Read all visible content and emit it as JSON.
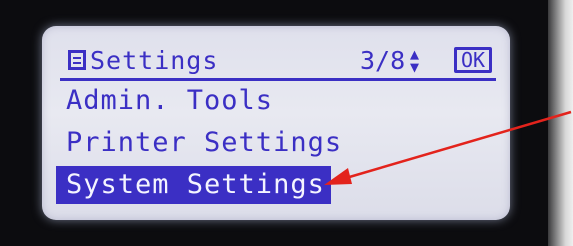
{
  "header": {
    "title": "Settings",
    "page_indicator": "3/8",
    "updown_glyph": "▲▼",
    "ok_label": "OK"
  },
  "menu": {
    "items": [
      {
        "label": "Admin. Tools",
        "selected": false
      },
      {
        "label": "Printer Settings",
        "selected": false
      },
      {
        "label": "System Settings",
        "selected": true
      }
    ]
  },
  "colors": {
    "lcd_background": "#e5e6ef",
    "lcd_text": "#3b2fc4",
    "selection_text": "#f4f4ff",
    "annotation_arrow": "#e3231c"
  },
  "icons": {
    "header_icon": "menu-list-icon",
    "scroll_icon": "up-down-arrows-icon"
  }
}
